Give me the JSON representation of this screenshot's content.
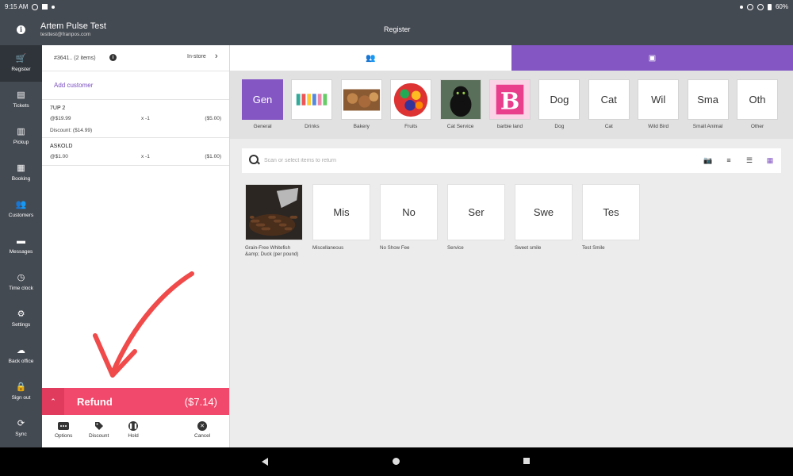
{
  "status": {
    "time": "9:15 AM",
    "battery": "60%"
  },
  "header": {
    "user_name": "Artem  Pulse Test",
    "user_email": "testtest@franpos.com",
    "title": "Register"
  },
  "sidebar": {
    "items": [
      {
        "label": "Register",
        "icon": "cart-icon",
        "glyph": "🛒"
      },
      {
        "label": "Tickets",
        "icon": "receipt-icon",
        "glyph": "▤"
      },
      {
        "label": "Pickup",
        "icon": "bag-icon",
        "glyph": "▥"
      },
      {
        "label": "Booking",
        "icon": "calendar-icon",
        "glyph": "▦"
      },
      {
        "label": "Customers",
        "icon": "people-icon",
        "glyph": "👥"
      },
      {
        "label": "Messages",
        "icon": "message-icon",
        "glyph": "▬"
      },
      {
        "label": "Time clock",
        "icon": "clock-icon",
        "glyph": "◷"
      },
      {
        "label": "Settings",
        "icon": "gear-icon",
        "glyph": "⚙"
      },
      {
        "label": "Back office",
        "icon": "cloud-icon",
        "glyph": "☁"
      },
      {
        "label": "Sign out",
        "icon": "lock-icon",
        "glyph": "🔒"
      },
      {
        "label": "Sync",
        "icon": "sync-icon",
        "glyph": "⟳"
      }
    ]
  },
  "order": {
    "number": "#3641.. (2 items)",
    "mode": "In-store",
    "add_customer": "Add customer",
    "lines": [
      {
        "name": "7UP 2",
        "price": "@$19.99",
        "qty": "x  -1",
        "amount": "($5.00)",
        "discount": "Discount: ($14.99)"
      },
      {
        "name": "ASKOLD",
        "price": "@$1.00",
        "qty": "x  -1",
        "amount": "($1.00)",
        "discount": ""
      }
    ],
    "refund_label": "Refund",
    "refund_total": "($7.14)",
    "actions": {
      "options": "Options",
      "discount": "Discount",
      "hold": "Hold",
      "cancel": "Cancel"
    }
  },
  "categories": [
    {
      "label": "General",
      "tile": "Gen",
      "active": true
    },
    {
      "label": "Drinks",
      "tile": ""
    },
    {
      "label": "Bakery",
      "tile": ""
    },
    {
      "label": "Fruits",
      "tile": ""
    },
    {
      "label": "Cat Service",
      "tile": ""
    },
    {
      "label": "barbie land",
      "tile": "B"
    },
    {
      "label": "Dog",
      "tile": "Dog"
    },
    {
      "label": "Cat",
      "tile": "Cat"
    },
    {
      "label": "Wild Bird",
      "tile": "Wil"
    },
    {
      "label": "Small Animal",
      "tile": "Sma"
    },
    {
      "label": "Other",
      "tile": "Oth"
    }
  ],
  "search": {
    "placeholder": "Scan or select items to return"
  },
  "items": [
    {
      "name": "Grain-Free Whitefish &amp; Duck (per pound)",
      "tile": ""
    },
    {
      "name": "Miscellaneous",
      "tile": "Mis"
    },
    {
      "name": "No Show Fee",
      "tile": "No"
    },
    {
      "name": "Service",
      "tile": "Ser"
    },
    {
      "name": "Sweet smile",
      "tile": "Swe"
    },
    {
      "name": "Test Smile",
      "tile": "Tes"
    }
  ],
  "colors": {
    "accent": "#8356c3",
    "refund": "#f1496b",
    "chrome": "#444a52",
    "annotation": "#f04a4a"
  }
}
